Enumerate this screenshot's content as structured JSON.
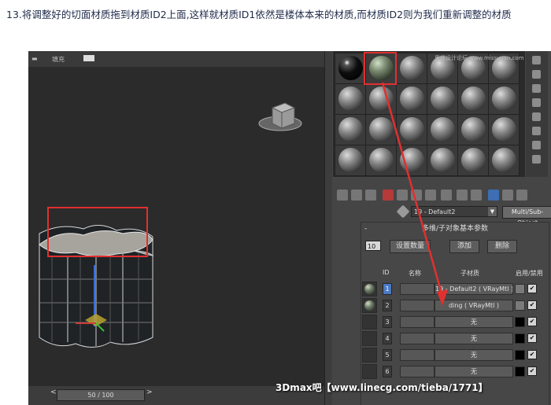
{
  "caption": "13.将调整好的切面材质拖到材质ID2上面,这样就材质ID1依然是楼体本来的材质,而材质ID2则为我们重新调整的材质",
  "viewport": {
    "label": "填充",
    "timeslider": "50 / 100",
    "prev": "<",
    "next": ">"
  },
  "material_editor": {
    "watermark_site": "思缘设计论坛 www.missyuan.com",
    "material_name": "19 - Default2",
    "material_type": "Multi/Sub-Object",
    "rollout_title": "多维/子对象基本参数",
    "rollout_collapse": "-",
    "count": "10",
    "buttons": {
      "set_count": "设置数量",
      "add": "添加",
      "delete": "删除"
    },
    "headers": {
      "id": "ID",
      "name": "名称",
      "submaterial": "子材质",
      "enable": "启用/禁用"
    },
    "rows": [
      {
        "id": "1",
        "submaterial": "19 - Default2 ( VRayMtl )",
        "checked": "✔"
      },
      {
        "id": "2",
        "submaterial": "ding ( VRayMtl )",
        "checked": "✔"
      },
      {
        "id": "3",
        "submaterial": "无",
        "checked": "✔"
      },
      {
        "id": "4",
        "submaterial": "无",
        "checked": "✔"
      },
      {
        "id": "5",
        "submaterial": "无",
        "checked": "✔"
      },
      {
        "id": "6",
        "submaterial": "无",
        "checked": "✔"
      }
    ]
  },
  "watermark": "3Dmax吧【www.linecg.com/tieba/1771】",
  "colors": {
    "highlight": "#e03030",
    "caption_text": "#1e2a4a"
  }
}
